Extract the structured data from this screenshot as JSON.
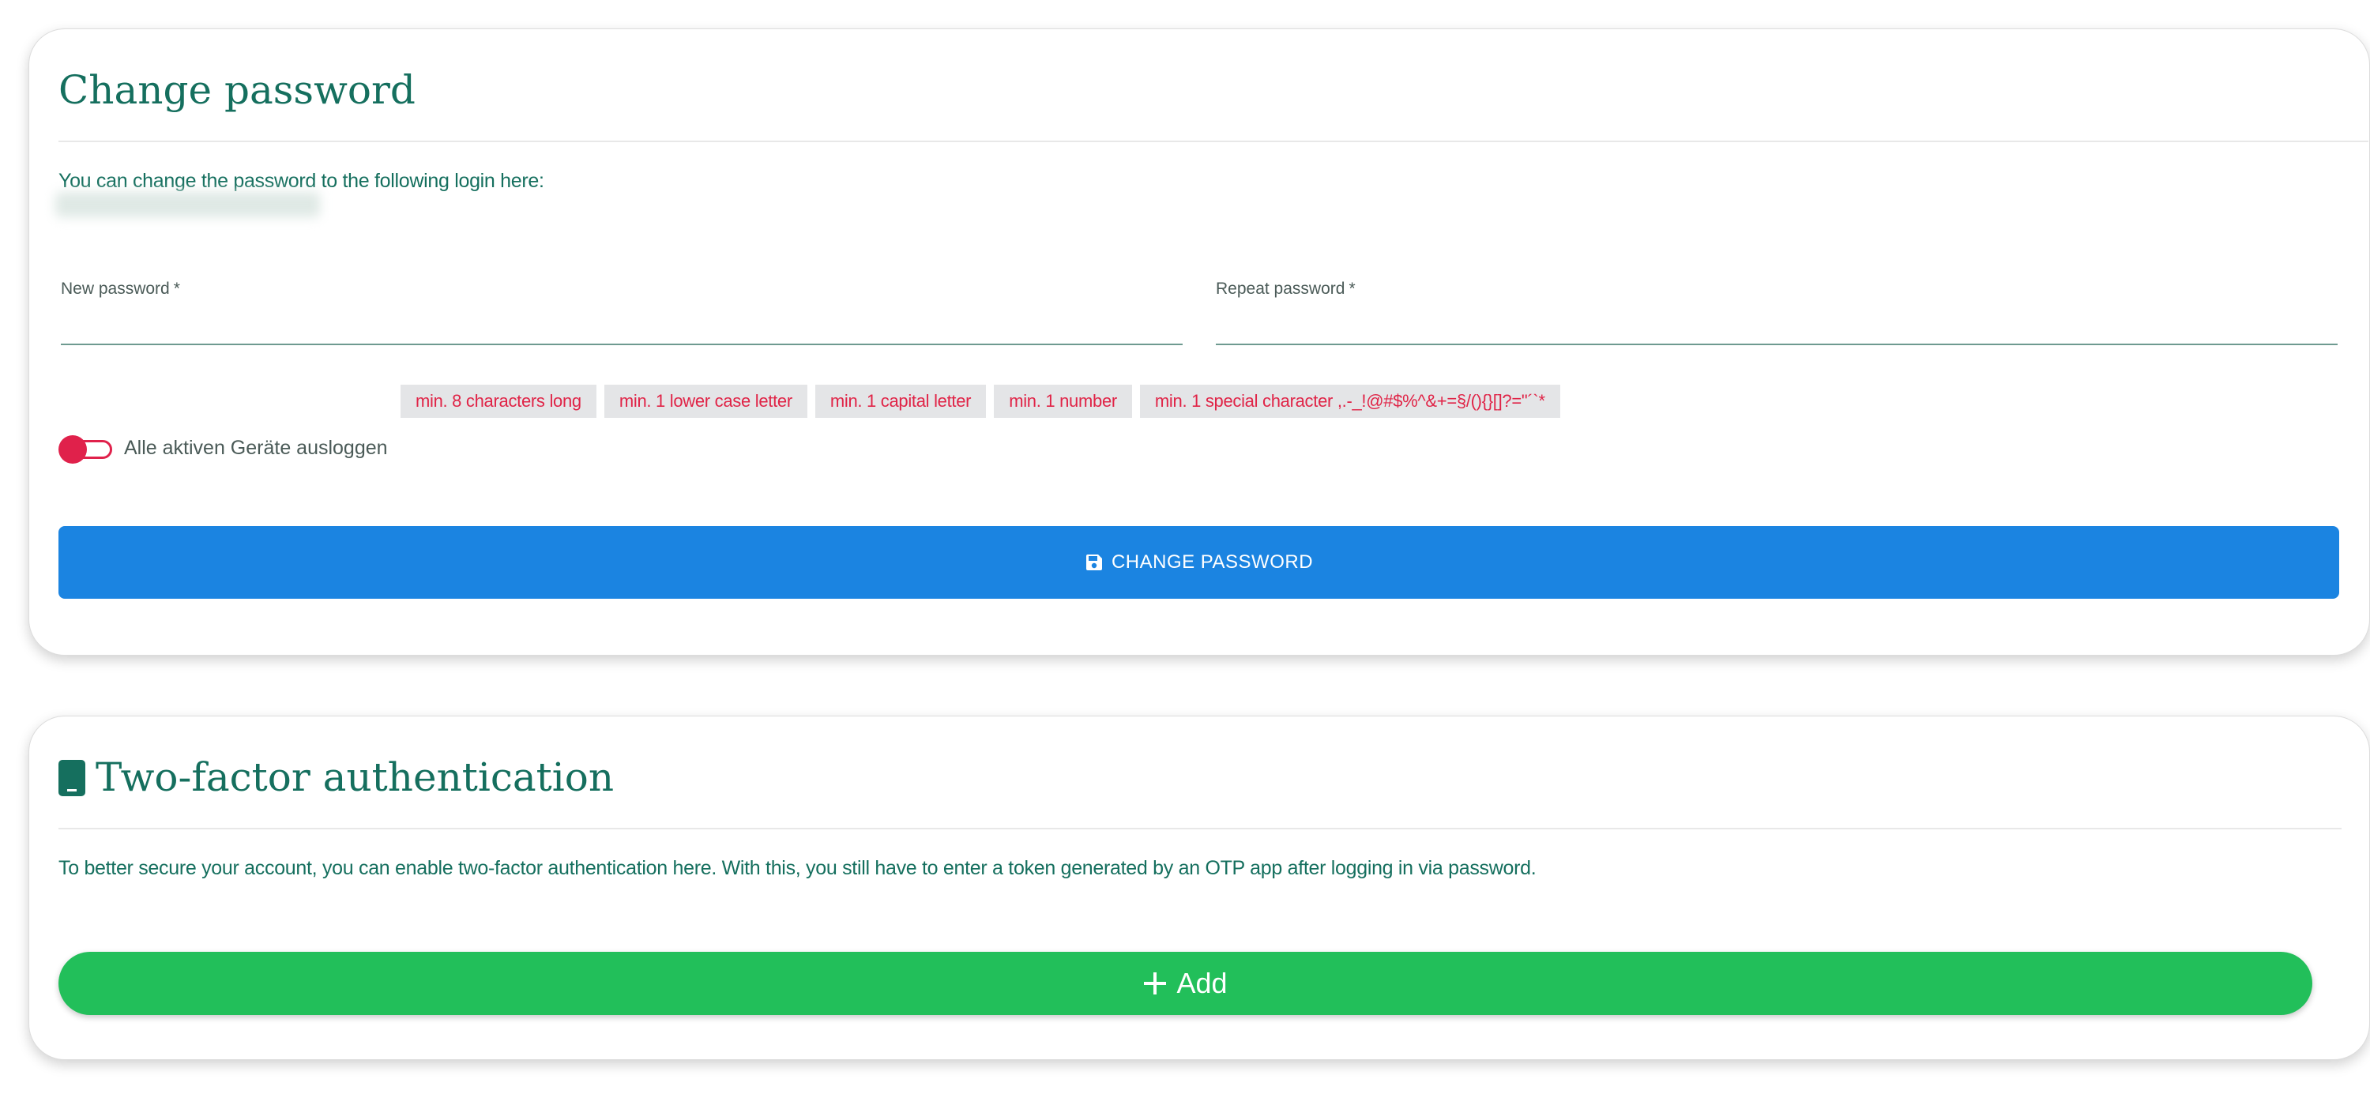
{
  "change_password": {
    "title": "Change password",
    "intro": "You can change the password to the following login here:",
    "new_password_label": "New password",
    "repeat_password_label": "Repeat password",
    "required_marker": "*",
    "new_password_value": "",
    "repeat_password_value": "",
    "requirements": [
      "min. 8 characters long",
      "min. 1 lower case letter",
      "min. 1 capital letter",
      "min. 1 number",
      "min. 1 special character ,.-_!@#$%^&+=§/(){}[]?=\"´`*"
    ],
    "logout_toggle_label": "Alle aktiven Geräte ausloggen",
    "logout_toggle_on": false,
    "submit_label": "CHANGE PASSWORD",
    "submit_icon": "save-icon"
  },
  "two_factor": {
    "title": "Two-factor authentication",
    "title_icon": "mobile-phone-icon",
    "description": "To better secure your account, you can enable two-factor authentication here. With this, you still have to enter a token generated by an OTP app after logging in via password.",
    "add_label": "Add",
    "add_icon": "plus-icon"
  },
  "colors": {
    "heading": "#156f5e",
    "primary_button": "#1b84e1",
    "success_button": "#22bf5a",
    "danger": "#e0214b",
    "chip_bg": "#e4e5e7"
  }
}
